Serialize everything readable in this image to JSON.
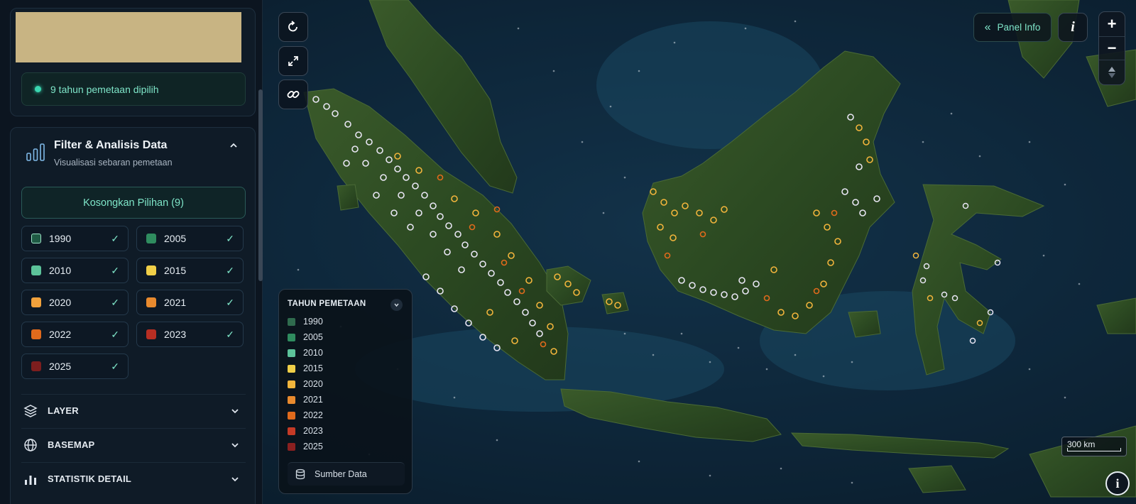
{
  "status": {
    "text": "9 tahun pemetaan dipilih"
  },
  "filter": {
    "title": "Filter & Analisis Data",
    "subtitle": "Visualisasi sebaran pemetaan",
    "clear_label": "Kosongkan Pilihan (9)",
    "check_glyph": "✓",
    "years": [
      {
        "label": "1990",
        "color": "#1f5a44",
        "checked": true
      },
      {
        "label": "2005",
        "color": "#2f8c5f",
        "checked": true
      },
      {
        "label": "2010",
        "color": "#5cc39a",
        "checked": true
      },
      {
        "label": "2015",
        "color": "#f0cf48",
        "checked": true
      },
      {
        "label": "2020",
        "color": "#f2a23c",
        "checked": true
      },
      {
        "label": "2021",
        "color": "#e98a2e",
        "checked": true
      },
      {
        "label": "2022",
        "color": "#e06a1c",
        "checked": true
      },
      {
        "label": "2023",
        "color": "#b72e23",
        "checked": true
      },
      {
        "label": "2025",
        "color": "#7d1e1e",
        "checked": true
      }
    ]
  },
  "sections": [
    {
      "label": "LAYER",
      "icon": "layers-icon"
    },
    {
      "label": "BASEMAP",
      "icon": "globe-icon"
    },
    {
      "label": "STATISTIK DETAIL",
      "icon": "bar-chart-icon"
    }
  ],
  "legend": {
    "title": "TAHUN PEMETAAN",
    "items": [
      {
        "label": "1990",
        "color": "#2f6b4e"
      },
      {
        "label": "2005",
        "color": "#2f8c5f"
      },
      {
        "label": "2010",
        "color": "#5cc39a"
      },
      {
        "label": "2015",
        "color": "#f0cf48"
      },
      {
        "label": "2020",
        "color": "#f2b53c"
      },
      {
        "label": "2021",
        "color": "#e98a2e"
      },
      {
        "label": "2022",
        "color": "#e06a1c"
      },
      {
        "label": "2023",
        "color": "#c43a26"
      },
      {
        "label": "2025",
        "color": "#8a2020"
      }
    ],
    "source_label": "Sumber Data"
  },
  "map": {
    "panel_info_label": "Panel Info",
    "panel_info_glyph": "«",
    "info_glyph": "i",
    "zoom_in": "+",
    "zoom_out": "−",
    "scale_label": "300 km",
    "accent": "#7fe6c9"
  }
}
